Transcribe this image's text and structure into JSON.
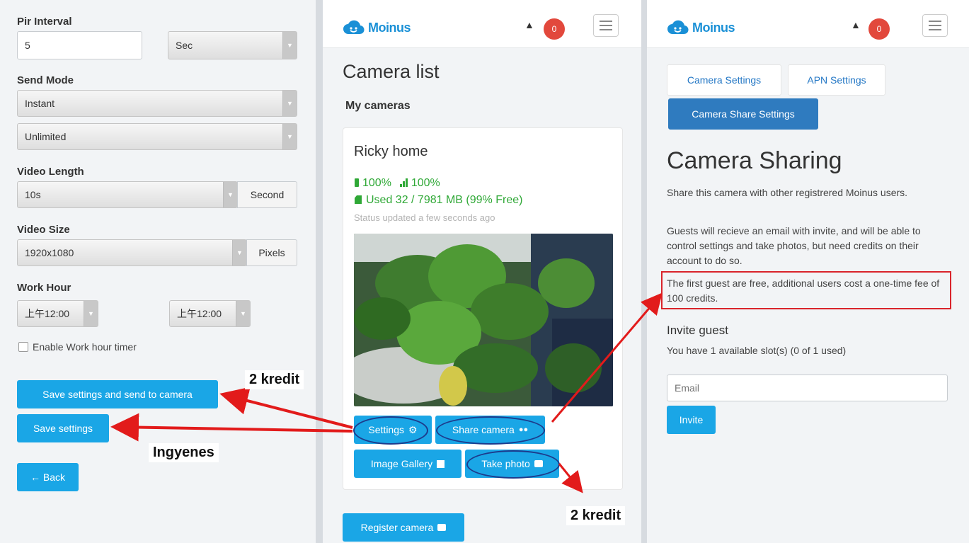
{
  "left": {
    "pir_label": "Pir Interval",
    "pir_value": "5",
    "pir_unit": "Sec",
    "send_mode_label": "Send Mode",
    "send_mode_value": "Instant",
    "limit_value": "Unlimited",
    "video_length_label": "Video Length",
    "video_length_value": "10s",
    "video_length_unit": "Second",
    "video_size_label": "Video Size",
    "video_size_value": "1920x1080",
    "video_size_unit": "Pixels",
    "work_hour_label": "Work Hour",
    "work_hour_start": "上午12:00",
    "work_hour_end": "上午12:00",
    "enable_timer_label": "Enable Work hour timer",
    "save_send_label": "Save settings and send to camera",
    "save_label": "Save settings",
    "back_label": "← Back"
  },
  "mid": {
    "logo": "Moinus",
    "notif_count": "0",
    "title": "Camera list",
    "subtitle": "My cameras",
    "camera_name": "Ricky home",
    "battery": "100%",
    "signal": "100%",
    "storage": "Used 32 / 7981 MB (99% Free)",
    "status": "Status updated a few seconds ago",
    "settings_label": "Settings",
    "share_label": "Share camera",
    "gallery_label": "Image Gallery",
    "photo_label": "Take photo",
    "register_label": "Register camera"
  },
  "right": {
    "logo": "Moinus",
    "notif_count": "0",
    "tab_camera": "Camera Settings",
    "tab_apn": "APN Settings",
    "tab_share": "Camera Share Settings",
    "title": "Camera Sharing",
    "p1": "Share this camera with other registrered Moinus users.",
    "p2": "Guests will recieve an email with invite, and will be able to control settings and take photos, but need credits on their account to do so.",
    "p3": "The first guest are free, additional users cost a one-time fee of 100 credits.",
    "invite_title": "Invite guest",
    "slots": "You have 1 available slot(s) (0 of 1 used)",
    "email_placeholder": "Email",
    "invite_label": "Invite"
  },
  "annotations": {
    "kredit_top": "2 kredit",
    "ingyenes": "Ingyenes",
    "kredit_bottom": "2 kredit"
  },
  "colors": {
    "primary": "#1aa6e6",
    "tab_active": "#2f7bbf",
    "arrow_red": "#e21b1b",
    "ok_green": "#2fa836"
  }
}
